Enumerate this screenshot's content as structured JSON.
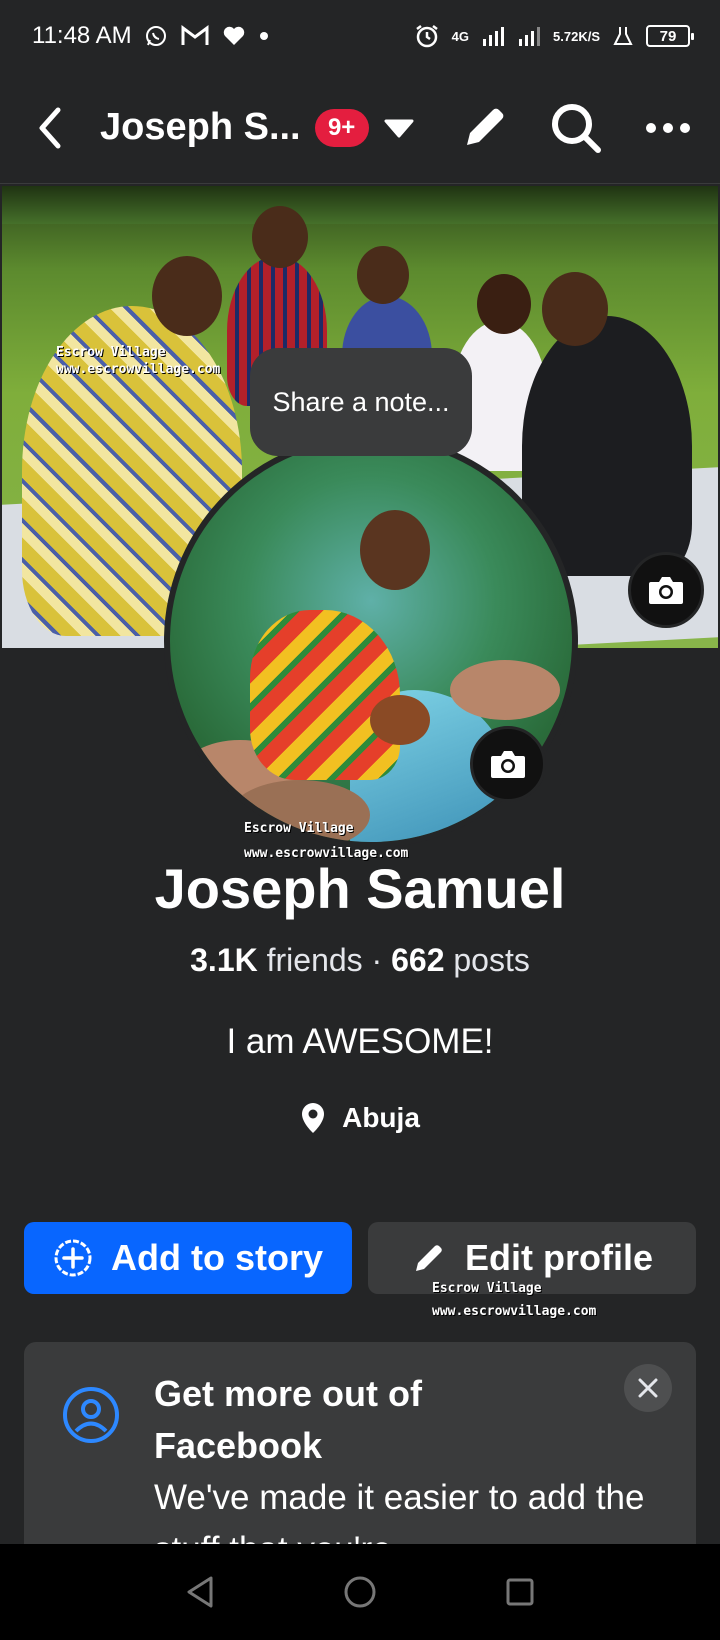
{
  "status_bar": {
    "time": "11:48 AM",
    "network": "4G",
    "speed_value": "5.72",
    "speed_unit": "K/S",
    "battery": "79",
    "icons": [
      "whatsapp-icon",
      "gmail-icon",
      "heart-icon",
      "dot-icon",
      "alarm-icon",
      "signal-icon",
      "signal-icon-2",
      "lab-icon"
    ]
  },
  "header": {
    "title": "Joseph S...",
    "badge": "9+",
    "actions": [
      "edit-icon",
      "search-icon",
      "more-icon"
    ]
  },
  "cover": {
    "watermark_line1": "Escrow Village",
    "watermark_line2": "www.escrowvillage.com"
  },
  "note": {
    "placeholder": "Share a note..."
  },
  "avatar": {
    "watermark_line1": "Escrow Village",
    "watermark_line2": "www.escrowvillage.com"
  },
  "profile": {
    "name": "Joseph Samuel",
    "friends_count": "3.1K",
    "friends_label": "friends",
    "separator": "·",
    "posts_count": "662",
    "posts_label": "posts",
    "bio": "I am AWESOME!",
    "location": "Abuja"
  },
  "buttons": {
    "add_story": "Add to story",
    "edit_profile": "Edit profile",
    "watermark_line1": "Escrow Village",
    "watermark_line2": "www.escrowvillage.com"
  },
  "card": {
    "title": "Get more out of Facebook",
    "body": "We've made it easier to add the stuff that you're"
  },
  "colors": {
    "background": "#242526",
    "primary": "#0866ff",
    "badge": "#e41e3f",
    "surface": "#3a3b3c"
  }
}
